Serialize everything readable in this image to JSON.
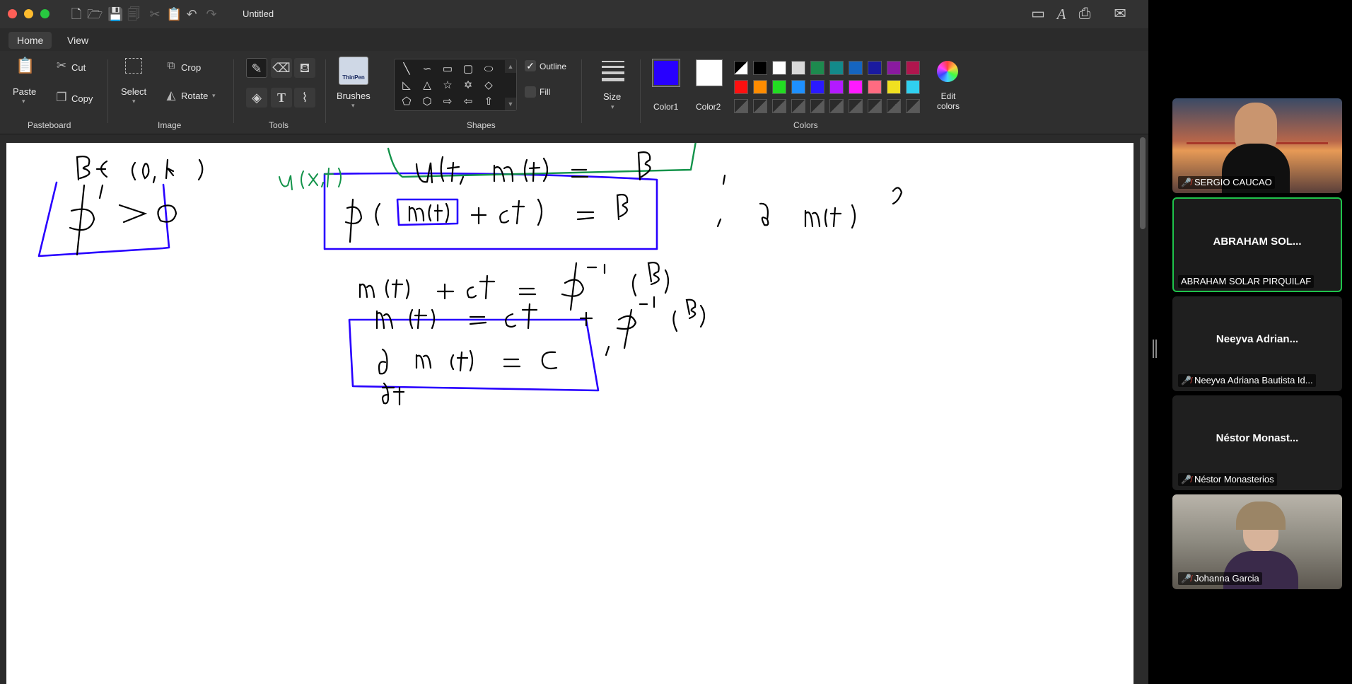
{
  "window": {
    "title": "Untitled"
  },
  "tabs": [
    {
      "label": "Home"
    },
    {
      "label": "View"
    }
  ],
  "ribbon": {
    "pasteboard": {
      "paste": "Paste",
      "cut": "Cut",
      "copy": "Copy",
      "label": "Pasteboard"
    },
    "image": {
      "select": "Select",
      "crop": "Crop",
      "rotate": "Rotate",
      "label": "Image"
    },
    "tools": {
      "label": "Tools"
    },
    "brushes": {
      "label": "Brushes",
      "thumb": "ThinPen"
    },
    "shapes": {
      "outline": "Outline",
      "fill": "Fill",
      "label": "Shapes"
    },
    "size": {
      "label": "Size"
    },
    "colors": {
      "color1": "Color1",
      "color2": "Color2",
      "edit": "Edit colors",
      "label": "Colors",
      "color1_value": "#2800ff",
      "color2_value": "#ffffff",
      "row1": [
        "#000000",
        "#ffffff",
        "#d9d9d9",
        "#1d8a4e",
        "#138a8a",
        "#1565c0",
        "#1a1aa0",
        "#8a1aa0",
        "#b0164e"
      ],
      "row2": [
        "#ff1010",
        "#ff8c00",
        "#22dd22",
        "#1e90ff",
        "#2a1aff",
        "#b31aff",
        "#ff1aff",
        "#ff6b81",
        "#f0e020",
        "#30d0f0"
      ]
    }
  },
  "participants": [
    {
      "name": "SERGIO CAUCAO",
      "muted": true,
      "video": "sunset-bridge"
    },
    {
      "display": "ABRAHAM SOL...",
      "name": "ABRAHAM SOLAR PIRQUILAF",
      "muted": false,
      "active": true
    },
    {
      "display": "Neeyva Adrian...",
      "name": "Neeyva Adriana Bautista Id...",
      "muted": true
    },
    {
      "display": "Néstor Monast...",
      "name": "Néstor Monasterios",
      "muted": true
    },
    {
      "name": "Johanna Garcia",
      "muted": true,
      "video": "office"
    }
  ],
  "whiteboard": {
    "expressions": [
      "β ∈ (0, k)",
      "ϕ′ > 0",
      "u(x,t)",
      "u(t, m(t)) = β",
      "ϕ(m(t) + ct) = β",
      "d/dt m(t) ?",
      "m(t) + ct = ϕ⁻¹(β)",
      "m(t) = ct + ϕ⁻¹(β)",
      "d/dt m(t) = C"
    ]
  }
}
